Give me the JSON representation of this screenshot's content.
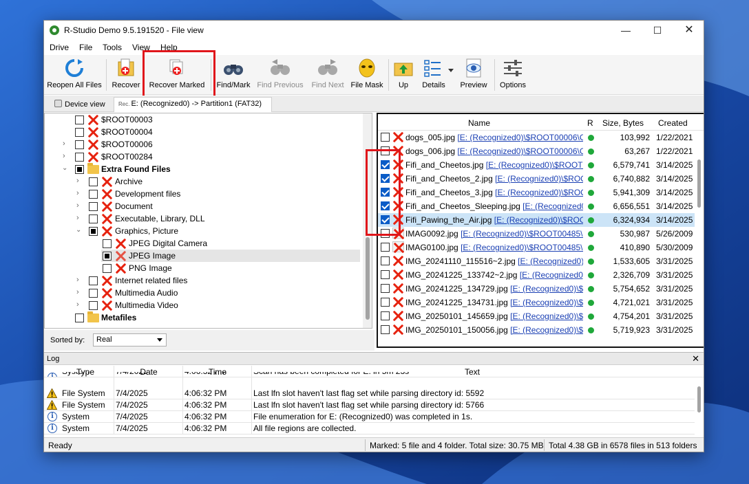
{
  "window": {
    "title": "R-Studio Demo 9.5.191520 - File view"
  },
  "menu": [
    "Drive",
    "File",
    "Tools",
    "View",
    "Help"
  ],
  "toolbar": {
    "reopen": "Reopen All Files",
    "recover": "Recover",
    "recover_marked": "Recover Marked",
    "find_mark": "Find/Mark",
    "find_previous": "Find Previous",
    "find_next": "Find Next",
    "file_mask": "File Mask",
    "up": "Up",
    "details": "Details",
    "preview": "Preview",
    "options": "Options"
  },
  "tabs": {
    "device_view": "Device view",
    "partition_prefix": "Rec.",
    "partition": "E: (Recognized0) -> Partition1 (FAT32)"
  },
  "tree": [
    "$ROOT00003",
    "$ROOT00004",
    "$ROOT00006",
    "$ROOT00284",
    "Extra Found Files",
    "Archive",
    "Development files",
    "Document",
    "Executable, Library, DLL",
    "Graphics, Picture",
    "JPEG Digital Camera",
    "JPEG Image",
    "PNG Image",
    "Internet related files",
    "Multimedia Audio",
    "Multimedia Video",
    "Metafiles"
  ],
  "sort": {
    "label": "Sorted by:",
    "value": "Real"
  },
  "files": {
    "columns": {
      "name": "Name",
      "r": "R",
      "size": "Size, Bytes",
      "created": "Created"
    },
    "rows": [
      {
        "name": "dogs_005.jpg",
        "path": "[E: (Recognized0)\\$ROOT00006\\Con",
        "size": "103,992",
        "date": "1/22/2021 ..."
      },
      {
        "name": "dogs_006.jpg",
        "path": "[E: (Recognized0)\\$ROOT00006\\Con",
        "size": "63,267",
        "date": "1/22/2021 ..."
      },
      {
        "name": "Fifi_and_Cheetos.jpg",
        "path": "[E: (Recognized0)\\$ROOT00",
        "size": "6,579,741",
        "date": "3/14/2025 ..."
      },
      {
        "name": "Fifi_and_Cheetos_2.jpg",
        "path": "[E: (Recognized0)\\$ROOT0",
        "size": "6,740,882",
        "date": "3/14/2025 ..."
      },
      {
        "name": "Fifi_and_Cheetos_3.jpg",
        "path": "[E: (Recognized0)\\$ROOT",
        "size": "5,941,309",
        "date": "3/14/2025 ..."
      },
      {
        "name": "Fifi_and_Cheetos_Sleeping.jpg",
        "path": "[E: (Recognized0)\\",
        "size": "6,656,551",
        "date": "3/14/2025 ..."
      },
      {
        "name": "Fifi_Pawing_the_Air.jpg",
        "path": "[E: (Recognized0)\\$ROOT",
        "size": "6,324,934",
        "date": "3/14/2025 ..."
      },
      {
        "name": "IMAG0092.jpg",
        "path": "[E: (Recognized0)\\$ROOT00485\\IM",
        "size": "530,987",
        "date": "5/26/2009 ..."
      },
      {
        "name": "IMAG0100.jpg",
        "path": "[E: (Recognized0)\\$ROOT00485\\IM",
        "size": "410,890",
        "date": "5/30/2009 ..."
      },
      {
        "name": "IMG_20241110_115516~2.jpg",
        "path": "[E: (Recognized0)\\$F",
        "size": "1,533,605",
        "date": "3/31/2025 ..."
      },
      {
        "name": "IMG_20241225_133742~2.jpg",
        "path": "[E: (Recognized0)\\$F",
        "size": "2,326,709",
        "date": "3/31/2025 ..."
      },
      {
        "name": "IMG_20241225_134729.jpg",
        "path": "[E: (Recognized0)\\$RO",
        "size": "5,754,652",
        "date": "3/31/2025 ..."
      },
      {
        "name": "IMG_20241225_134731.jpg",
        "path": "[E: (Recognized0)\\$RO",
        "size": "4,721,021",
        "date": "3/31/2025 ..."
      },
      {
        "name": "IMG_20250101_145659.jpg",
        "path": "[E: (Recognized0)\\$RO",
        "size": "4,754,201",
        "date": "3/31/2025 ..."
      },
      {
        "name": "IMG_20250101_150056.jpg",
        "path": "[E: (Recognized0)\\$RO",
        "size": "5,719,923",
        "date": "3/31/2025 ..."
      }
    ]
  },
  "log": {
    "title": "Log",
    "columns": {
      "type": "Type",
      "date": "Date",
      "time": "Time",
      "text": "Text"
    },
    "rows": [
      {
        "type": "System",
        "date": "7/4/2025",
        "time": "4:06:32 PM",
        "text": "Scan has been completed for E: in 5m 23s"
      },
      {
        "type": "File System",
        "date": "7/4/2025",
        "time": "4:06:32 PM",
        "text": "Last lfn slot haven't last flag set while parsing directory id: 5592"
      },
      {
        "type": "File System",
        "date": "7/4/2025",
        "time": "4:06:32 PM",
        "text": "Last lfn slot haven't last flag set while parsing directory id: 5766"
      },
      {
        "type": "System",
        "date": "7/4/2025",
        "time": "4:06:32 PM",
        "text": "File enumeration for E: (Recognized0) was completed in 1s."
      },
      {
        "type": "System",
        "date": "7/4/2025",
        "time": "4:06:32 PM",
        "text": "All file regions are collected."
      }
    ]
  },
  "status": {
    "ready": "Ready",
    "marked": "Marked: 5 file and 4 folder. Total size: 30.75 MB",
    "total": "Total 4.38 GB in 6578 files in 513 folders"
  },
  "colors": {
    "highlight": "#e0161b",
    "accent": "#0b5cc7",
    "link": "#1a3fb3",
    "status_ok": "#1fa83a"
  }
}
